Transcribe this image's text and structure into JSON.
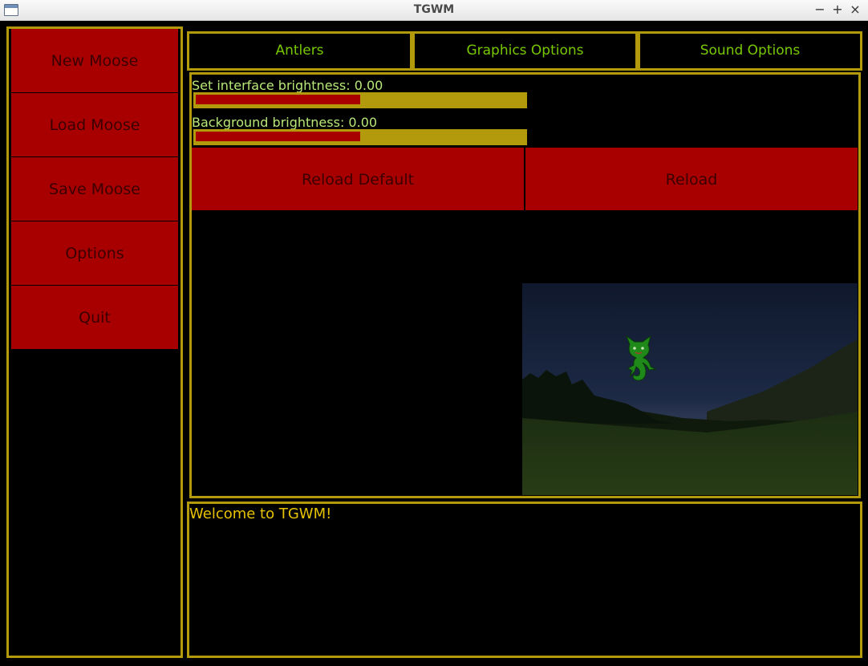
{
  "window": {
    "title": "TGWM",
    "controls": [
      "−",
      "+",
      "×"
    ]
  },
  "sidebar": {
    "items": [
      {
        "label": "New Moose"
      },
      {
        "label": "Load Moose"
      },
      {
        "label": "Save Moose"
      },
      {
        "label": "Options"
      },
      {
        "label": "Quit"
      }
    ]
  },
  "tabs": [
    {
      "label": "Antlers"
    },
    {
      "label": "Graphics Options"
    },
    {
      "label": "Sound Options"
    }
  ],
  "sliders": [
    {
      "label": "Set interface brightness: 0.00",
      "value": 0.5
    },
    {
      "label": "Background brightness: 0.00",
      "value": 0.5
    }
  ],
  "buttons": {
    "reload_default": "Reload Default",
    "reload": "Reload"
  },
  "preview": {
    "icon": "green-cat-creature",
    "scene": "night-meadow-landscape"
  },
  "log": {
    "message": "Welcome to TGWM!"
  },
  "colors": {
    "accent_border": "#b29a0c",
    "button_red": "#a80000",
    "tab_text": "#78c800",
    "label_text": "#b8e878",
    "log_text": "#e6c200"
  }
}
